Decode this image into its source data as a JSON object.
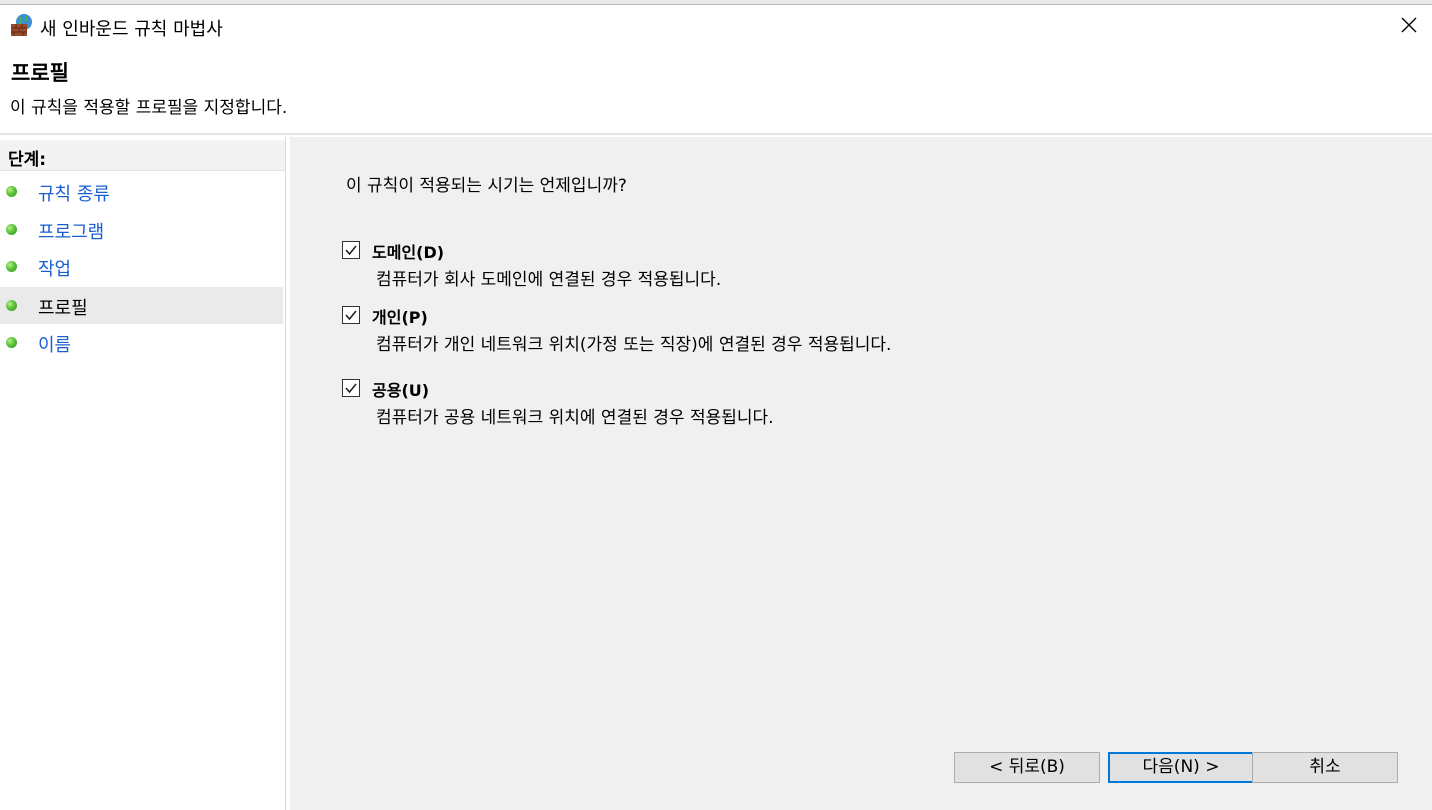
{
  "window": {
    "title": "새 인바운드 규칙 마법사"
  },
  "header": {
    "title": "프로필",
    "subtitle": "이 규칙을 적용할 프로필을 지정합니다."
  },
  "sidebar": {
    "heading": "단계:",
    "steps": [
      {
        "label": "규칙 종류",
        "current": false
      },
      {
        "label": "프로그램",
        "current": false
      },
      {
        "label": "작업",
        "current": false
      },
      {
        "label": "프로필",
        "current": true
      },
      {
        "label": "이름",
        "current": false
      }
    ]
  },
  "main": {
    "question": "이 규칙이 적용되는 시기는 언제입니까?",
    "options": [
      {
        "label": "도메인(D)",
        "description": "컴퓨터가 회사 도메인에 연결된 경우 적용됩니다.",
        "checked": true
      },
      {
        "label": "개인(P)",
        "description": "컴퓨터가 개인 네트워크 위치(가정 또는 직장)에 연결된 경우 적용됩니다.",
        "checked": true
      },
      {
        "label": "공용(U)",
        "description": "컴퓨터가 공용 네트워크 위치에 연결된 경우 적용됩니다.",
        "checked": true
      }
    ]
  },
  "buttons": {
    "back": "< 뒤로(B)",
    "next": "다음(N) >",
    "cancel": "취소"
  },
  "icons": {
    "app": "firewall-brick-globe-icon",
    "close": "close-icon",
    "step_bullet": "green-dot-icon",
    "check": "checkmark-icon"
  }
}
